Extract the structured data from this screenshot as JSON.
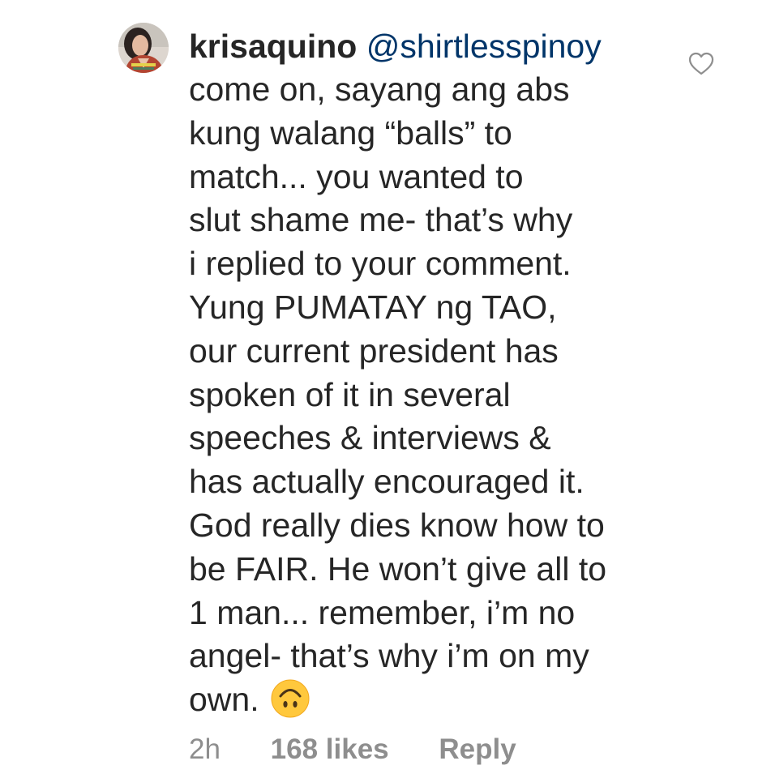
{
  "comment": {
    "username": "krisaquino",
    "mention": "@shirtlesspinoy",
    "lines": [
      "come on, sayang ang abs",
      "kung walang “balls” to",
      "match... you wanted to",
      "slut shame me- that’s why",
      "i replied to your comment.",
      "Yung PUMATAY ng TAO,",
      "our current president has",
      "spoken of it in several",
      "speeches & interviews &",
      "has actually encouraged it.",
      "God really dies know how to",
      "be FAIR. He won’t give all to",
      "1 man... remember, i’m no",
      "angel- that’s why i’m on my",
      "own."
    ],
    "emoji": "upside-down-face-emoji",
    "time": "2h",
    "likes": "168 likes",
    "reply": "Reply"
  },
  "icons": {
    "like": "heart-outline-icon",
    "avatar": "profile-avatar"
  },
  "colors": {
    "text": "#262626",
    "mention": "#003569",
    "meta": "#8e8e8e",
    "emoji": "#FFC83D"
  }
}
